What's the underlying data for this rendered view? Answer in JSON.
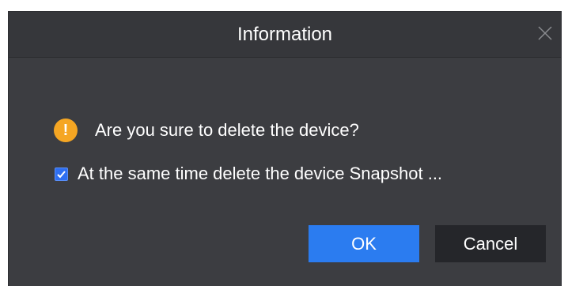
{
  "dialog": {
    "title": "Information",
    "close_icon": "close-icon",
    "message": {
      "icon": "warning-icon",
      "icon_glyph": "!",
      "text": "Are you sure to delete the device?"
    },
    "checkbox": {
      "checked": true,
      "label": "At the same time delete the device Snapshot ..."
    },
    "buttons": {
      "ok": "OK",
      "cancel": "Cancel"
    },
    "colors": {
      "background": "#3c3d41",
      "warning": "#f5a623",
      "primary": "#2b7cf0",
      "secondary": "#25262a"
    }
  }
}
